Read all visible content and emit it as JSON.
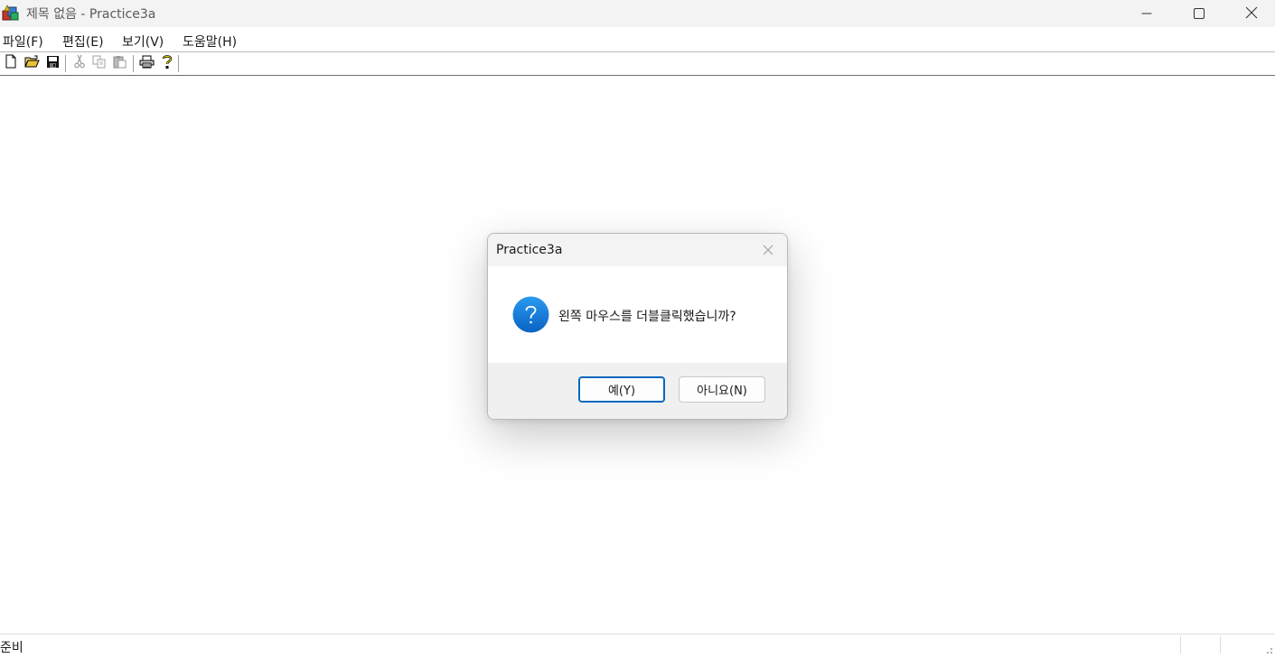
{
  "window": {
    "title": "제목 없음 - Practice3a",
    "icon": "app-icon",
    "caption_buttons": [
      "minimize-icon",
      "maximize-icon",
      "close-icon"
    ]
  },
  "menubar": {
    "items": [
      {
        "label": "파일(F)"
      },
      {
        "label": "편집(E)"
      },
      {
        "label": "보기(V)"
      },
      {
        "label": "도움말(H)"
      }
    ]
  },
  "toolbar": {
    "buttons": [
      "new-file-icon",
      "open-folder-icon",
      "save-icon",
      "cut-icon",
      "copy-icon",
      "paste-icon",
      "print-icon",
      "help-icon"
    ]
  },
  "statusbar": {
    "text": "준비"
  },
  "dialog": {
    "title": "Practice3a",
    "icon": "question-icon",
    "accent_color": "#0078d4",
    "message": "왼쪽 마우스를 더블클릭했습니까?",
    "yes_label": "예(Y)",
    "no_label": "아니요(N)"
  }
}
